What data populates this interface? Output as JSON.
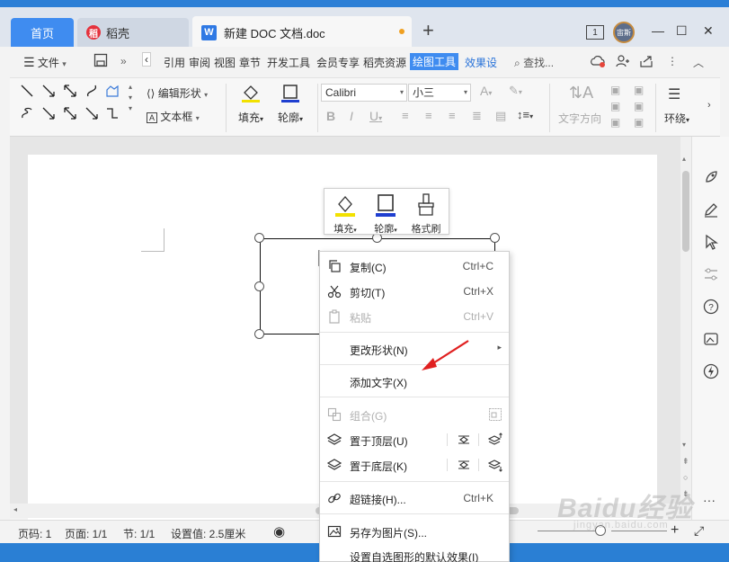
{
  "tabs": {
    "home": "首页",
    "daoke": "稻壳",
    "doc": "新建 DOC 文档.doc",
    "new_tab": "+"
  },
  "window": {
    "badge": "1",
    "avatar": "宙斯",
    "min": "—",
    "max": "☐",
    "close": "✕"
  },
  "menu": {
    "file": "文件",
    "items": [
      "引用",
      "审阅",
      "视图",
      "章节",
      "开发工具",
      "会员专享",
      "稻壳资源"
    ],
    "active": "绘图工具",
    "effect": "效果设",
    "search": "查找..."
  },
  "ribbon": {
    "edit_shape": "编辑形状",
    "text_box": "文本框",
    "fill": "填充",
    "outline": "轮廓",
    "font_name": "Calibri",
    "font_size": "小三",
    "text_direction": "文字方向",
    "wrap": "环绕",
    "accent_yellow": "#f2e100",
    "accent_blue": "#1f3fd0"
  },
  "float_toolbar": {
    "fill": "填充",
    "outline": "轮廓",
    "format_painter": "格式刷"
  },
  "context_menu": {
    "copy": {
      "label": "复制(C)",
      "shortcut": "Ctrl+C"
    },
    "cut": {
      "label": "剪切(T)",
      "shortcut": "Ctrl+X"
    },
    "paste": {
      "label": "粘贴",
      "shortcut": "Ctrl+V"
    },
    "change_shape": {
      "label": "更改形状(N)"
    },
    "add_text": {
      "label": "添加文字(X)"
    },
    "group": {
      "label": "组合(G)"
    },
    "bring_front": {
      "label": "置于顶层(U)"
    },
    "send_back": {
      "label": "置于底层(K)"
    },
    "hyperlink": {
      "label": "超链接(H)...",
      "shortcut": "Ctrl+K"
    },
    "save_as_image": {
      "label": "另存为图片(S)..."
    },
    "set_default": {
      "label": "设置自选图形的默认效果(I)"
    }
  },
  "status": {
    "page_no": "页码: 1",
    "pages": "页面: 1/1",
    "section": "节: 1/1",
    "setting": "设置值: 2.5厘米"
  },
  "watermark": {
    "text": "Baidu经验",
    "sub": "jingyan.baidu.com"
  }
}
